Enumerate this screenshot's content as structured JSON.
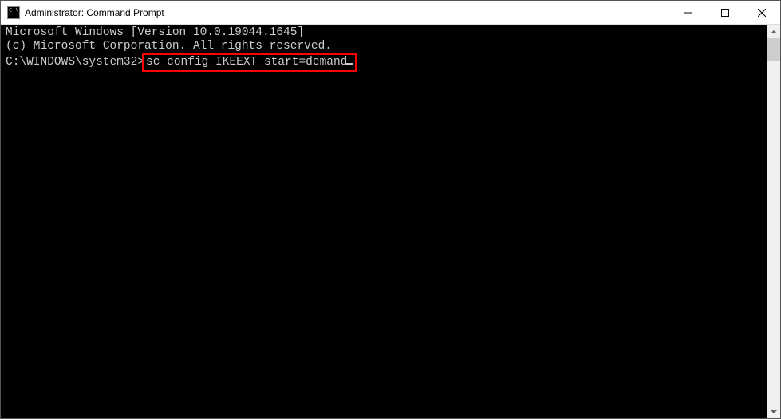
{
  "window": {
    "title": "Administrator: Command Prompt"
  },
  "terminal": {
    "line1": "Microsoft Windows [Version 10.0.19044.1645]",
    "line2": "(c) Microsoft Corporation. All rights reserved.",
    "blank": "",
    "prompt": "C:\\WINDOWS\\system32>",
    "command": "sc config IKEEXT start=demand"
  }
}
